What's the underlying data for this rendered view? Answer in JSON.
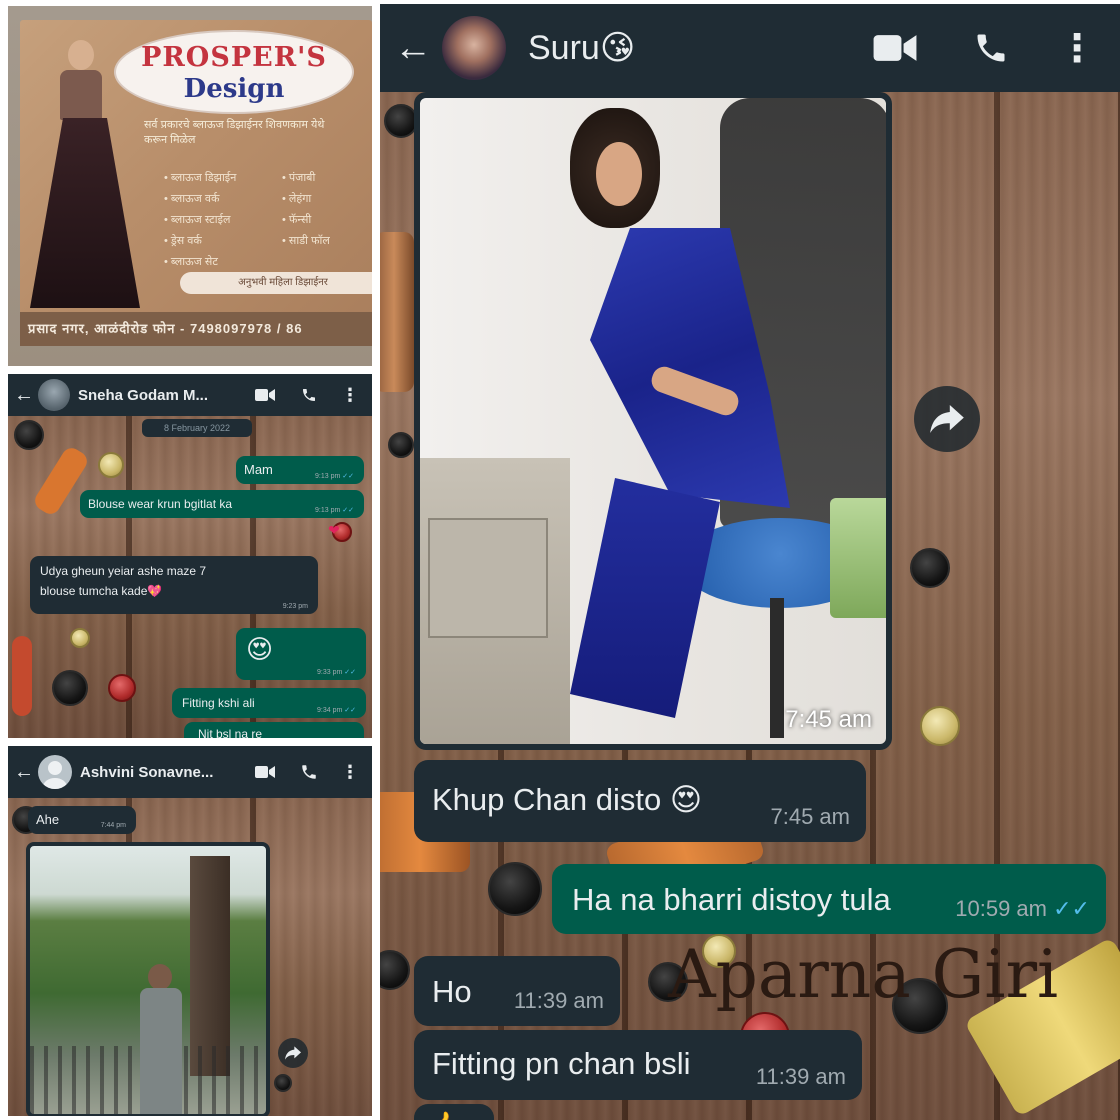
{
  "poster": {
    "logo_line1": "PROSPER'S",
    "logo_line2": "Design",
    "tagline": "सर्व प्रकारचे ब्लाऊज डिझाईनर शिवणकाम येथे करून मिळेल",
    "list_left": [
      "ब्लाऊज डिझाईन",
      "ब्लाऊज वर्क",
      "ब्लाऊज स्टाईल",
      "ड्रेस वर्क",
      "ब्लाऊज सेट"
    ],
    "list_right": [
      "पंजाबी",
      "लेहंगा",
      "फॅन्सी",
      "साडी फॉल"
    ],
    "pill_text": "अनुभवी महिला डिझाईनर",
    "footer_text": "प्रसाद नगर, आळंदीरोड  फोन - 7498097978 / 86"
  },
  "chat_a": {
    "contact_name": "Sneha Godam M...",
    "date_chip": "8 February 2022",
    "messages": [
      {
        "dir": "out",
        "text": "Mam",
        "time": "9:13 pm",
        "ticks": "✓✓"
      },
      {
        "dir": "out",
        "text": "Blouse wear krun bgitlat ka",
        "time": "9:13 pm",
        "ticks": "✓✓"
      },
      {
        "dir": "in",
        "text": "Udya gheun yeiar ashe maze 7",
        "text2": "blouse tumcha kade💖",
        "time": "9:23 pm"
      },
      {
        "dir": "out",
        "text": "😍",
        "time": "9:33 pm",
        "ticks": "✓✓"
      },
      {
        "dir": "out",
        "text": "Fitting kshi ali",
        "time": "9:34 pm",
        "ticks": "✓✓"
      },
      {
        "dir": "out",
        "text": "Nit bsl na re",
        "time": "",
        "ticks": ""
      }
    ],
    "reaction": "❤"
  },
  "chat_b": {
    "contact_name": "Ashvini Sonavne...",
    "date_chip": "",
    "messages": [
      {
        "dir": "in",
        "text": "Ahe",
        "time": "7:44 pm"
      }
    ]
  },
  "chat_c": {
    "contact_name": "Suru😘",
    "photo_time": "7:45 am",
    "messages": [
      {
        "dir": "in",
        "text": "Khup Chan disto 😍",
        "time": "7:45 am"
      },
      {
        "dir": "out",
        "text": "Ha na bharri distoy tula",
        "time": "10:59 am",
        "ticks": "✓✓"
      },
      {
        "dir": "in",
        "text": "Ho",
        "time": "11:39 am"
      },
      {
        "dir": "in",
        "text": "Fitting pn chan bsli",
        "time": "11:39 am"
      }
    ],
    "bottom_emoji": "👍"
  },
  "watermark": "Aparna Giri",
  "colors": {
    "header_bg": "#1f2c34",
    "bubble_in": "#1f2c34",
    "bubble_out": "#005c4b",
    "read_ticks": "#53bdeb"
  },
  "icons": {
    "back": "back-arrow-icon",
    "video": "video-call-icon",
    "voice": "voice-call-icon",
    "menu": "more-options-icon",
    "forward": "forward-icon"
  }
}
